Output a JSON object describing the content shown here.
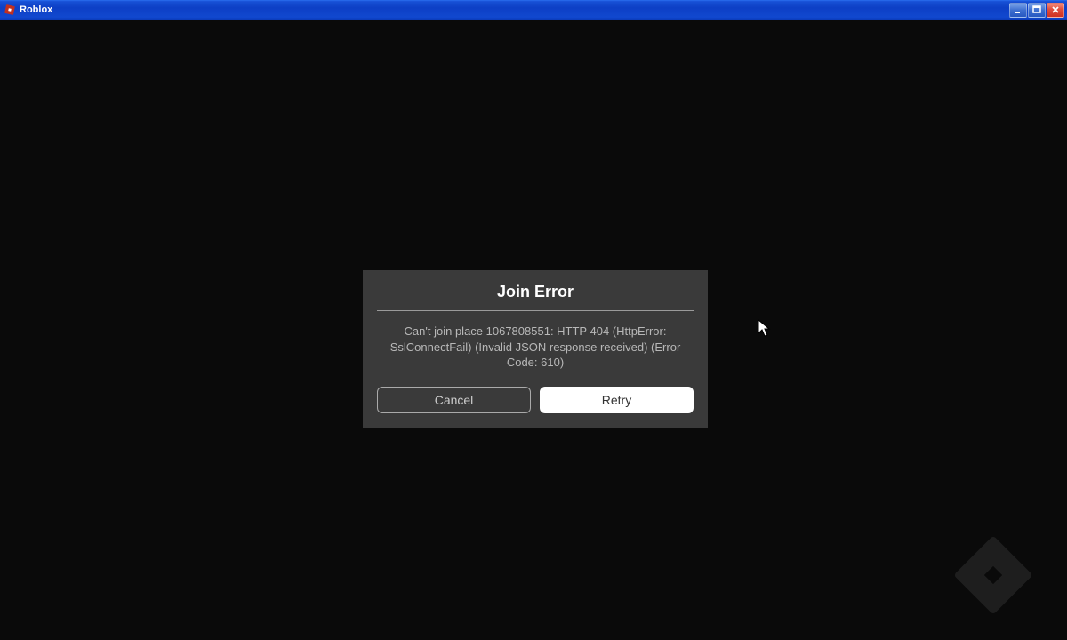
{
  "window": {
    "title": "Roblox"
  },
  "dialog": {
    "title": "Join Error",
    "message": "Can't join place 1067808551: HTTP 404 (HttpError: SslConnectFail) (Invalid JSON response received) (Error Code: 610)",
    "cancel_label": "Cancel",
    "retry_label": "Retry"
  }
}
